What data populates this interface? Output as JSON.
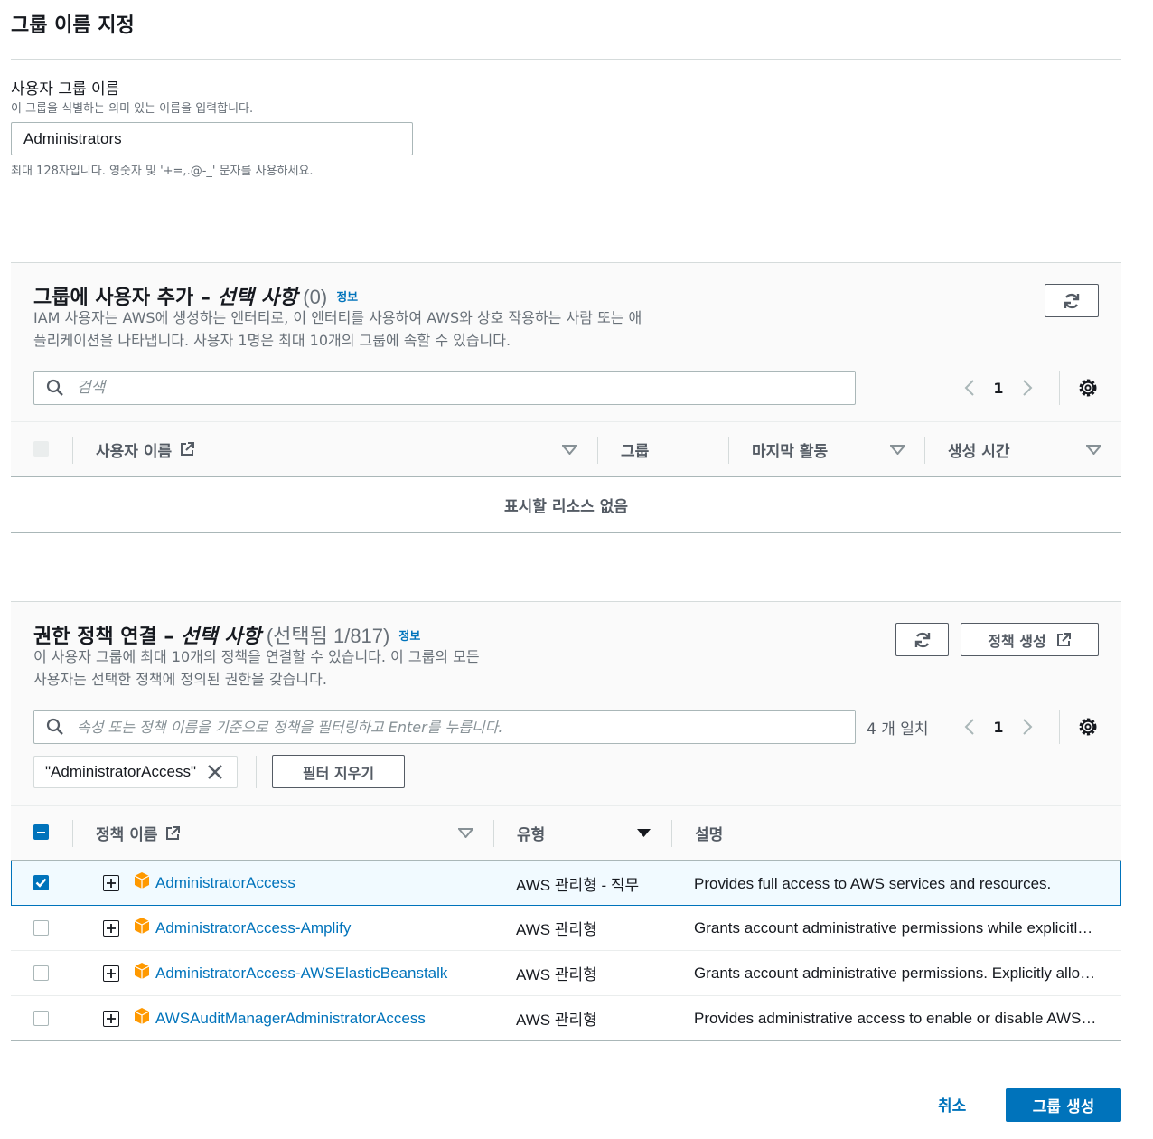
{
  "group_name_section": {
    "title": "그룹 이름 지정",
    "label": "사용자 그룹 이름",
    "description": "이 그룹을 식별하는 의미 있는 이름을 입력합니다.",
    "value": "Administrators",
    "constraint": "최대 128자입니다. 영숫자 및 '+=,.@-_' 문자를 사용하세요."
  },
  "add_users": {
    "title_main": "그룹에 사용자 추가 – ",
    "title_optional": "선택 사항",
    "title_count": " (0)",
    "info": "정보",
    "description_line1": "IAM 사용자는 AWS에 생성하는 엔터티로, 이 엔터티를 사용하여 AWS와 상호 작용하는 사람 또는 애",
    "description_line2": "플리케이션을 나타냅니다. 사용자 1명은 최대 10개의 그룹에 속할 수 있습니다.",
    "search_placeholder": "검색",
    "page": "1",
    "columns": [
      "사용자 이름",
      "그룹",
      "마지막 활동",
      "생성 시간"
    ],
    "empty_text": "표시할 리소스 없음"
  },
  "policies": {
    "title_main": "권한 정책 연결 – ",
    "title_optional": "선택 사항",
    "title_count": " (선택됨 1/817)",
    "info": "정보",
    "create_policy": "정책 생성",
    "description_line1": "이 사용자 그룹에 최대 10개의 정책을 연결할 수 있습니다. 이 그룹의 모든",
    "description_line2": "사용자는 선택한 정책에 정의된 권한을 갖습니다.",
    "search_placeholder": "속성 또는 정책 이름을 기준으로 정책을 필터링하고 Enter를 누릅니다.",
    "match_count": "4 개 일치",
    "page": "1",
    "filter_token": "\"AdministratorAccess\"",
    "clear_filter": "필터 지우기",
    "columns": [
      "정책 이름",
      "유형",
      "설명"
    ],
    "rows": [
      {
        "name": "AdministratorAccess",
        "type": "AWS 관리형 - 직무",
        "description": "Provides full access to AWS services and resources.",
        "selected": true
      },
      {
        "name": "AdministratorAccess-Amplify",
        "type": "AWS 관리형",
        "description": "Grants account administrative permissions while explicitly allowing direct access to resources needed by Amplify applications.",
        "selected": false
      },
      {
        "name": "AdministratorAccess-AWSElasticBeanstalk",
        "type": "AWS 관리형",
        "description": "Grants account administrative permissions. Explicitly allows developers and administrators to gain direct access to resources.",
        "selected": false
      },
      {
        "name": "AWSAuditManagerAdministratorAccess",
        "type": "AWS 관리형",
        "description": "Provides administrative access to enable or disable AWS Audit Manager.",
        "selected": false
      }
    ]
  },
  "footer": {
    "cancel": "취소",
    "create_group": "그룹 생성"
  },
  "colors": {
    "accent": "#0073bb",
    "package_icon": "#ff9900"
  }
}
